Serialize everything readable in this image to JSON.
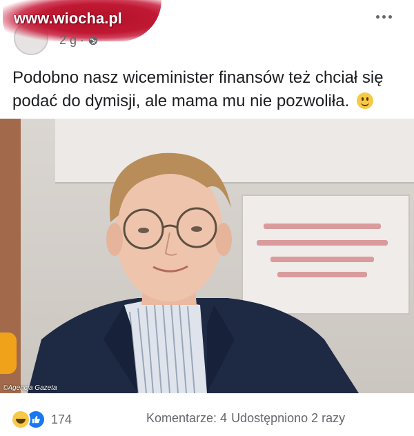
{
  "header": {
    "watermark": "www.wiocha.pl",
    "timestamp": "2 g ·",
    "privacy_icon": "globe-icon"
  },
  "post": {
    "text_line1": "Podobno nasz wiceminister finansów też chciał się",
    "text_line2": "podać do dymisji, ale mama mu nie pozwoliła.",
    "emoji": "slightly-smiling-face"
  },
  "photo": {
    "credit": "©Agencja Gazeta"
  },
  "footer": {
    "reaction_count": "174",
    "comments": "Komentarze: 4",
    "shares": "Udostępniono 2 razy"
  },
  "colors": {
    "watermark_blob": "#c01833",
    "like_blue": "#1877f2",
    "secondary_text": "#65676b"
  }
}
